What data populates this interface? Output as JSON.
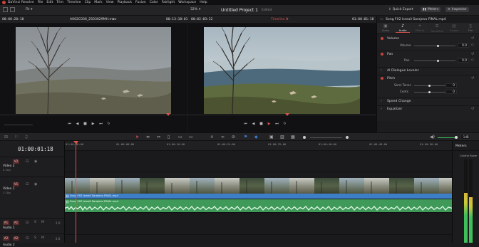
{
  "menubar": [
    "DaVinci Resolve",
    "File",
    "Edit",
    "Trim",
    "Timeline",
    "Clip",
    "Mark",
    "View",
    "Playback",
    "Fusion",
    "Color",
    "Fairlight",
    "Workspace",
    "Help"
  ],
  "header": {
    "project_title": "Untitled Project 1",
    "edited": "Edited",
    "zoom_left": "Fit",
    "zoom_right": "32%",
    "quick_export": "Quick Export",
    "meters": "Meters",
    "inspector": "Inspector"
  },
  "source_viewer": {
    "timecode_left": "00:00:20:10",
    "clip_name": "A002C036_2503029MH.mov",
    "timecode_right": "00:13:18:01"
  },
  "timeline_viewer": {
    "timecode_left": "00:02:03:22",
    "timeline_name": "Timeline 1",
    "timecode_right": "01:00:01:18"
  },
  "inspector": {
    "clip_title": "Song FX2 Ismail Sarajevo FINAL.mp4",
    "tabs": [
      "Video",
      "Audio",
      "Effects",
      "Transition",
      "Image",
      "File"
    ],
    "active_tab": "Audio",
    "volume_label": "Volume",
    "volume_param": "Volume",
    "volume_value": "0.0",
    "pan_label": "Pan",
    "pan_param": "Pan",
    "pan_value": "0.0",
    "ai_dialogue": "AI Dialogue Leveler",
    "pitch_label": "Pitch",
    "semitones_label": "Semi Tones",
    "semitones_value": "0",
    "cents_label": "Cents",
    "cents_value": "0",
    "speed_change": "Speed Change",
    "equalizer": "Equalizer"
  },
  "edit_toolbar": {
    "volume_level": "-1dB"
  },
  "timeline": {
    "current_tc": "01:00:01:18",
    "ruler": [
      "01:00:00:00",
      "01:00:08:00",
      "01:00:16:00",
      "01:00:24:00",
      "01:00:32:00",
      "01:00:40:00",
      "01:00:48:00",
      "01:00:56:00"
    ],
    "tracks": [
      {
        "badge": "V2",
        "name": "Video 2",
        "sub": "0 Clip"
      },
      {
        "badge": "V1",
        "name": "Video 1",
        "sub": "1 Clip"
      },
      {
        "badge": "A1",
        "name": "Audio 1",
        "sub": "2.0"
      },
      {
        "badge": "A2",
        "name": "Audio 2",
        "sub": "2.0"
      }
    ],
    "a1_badge_left": "A1",
    "a2_badge_left": "A2",
    "video_clip_name": "Song FX2 Ismail Sarajevo FINAL.mp4",
    "audio_clip_name": "Song FX2 Ismail Sarajevo FINAL.mp4"
  },
  "meters_panel": {
    "title": "Meters",
    "control_room": "Control Room",
    "left_level": 0.6,
    "right_level": 0.55
  },
  "colors": {
    "accent_red": "#c8443c",
    "video_track": "#3d7fc6",
    "audio_track": "#3f9a5a"
  }
}
